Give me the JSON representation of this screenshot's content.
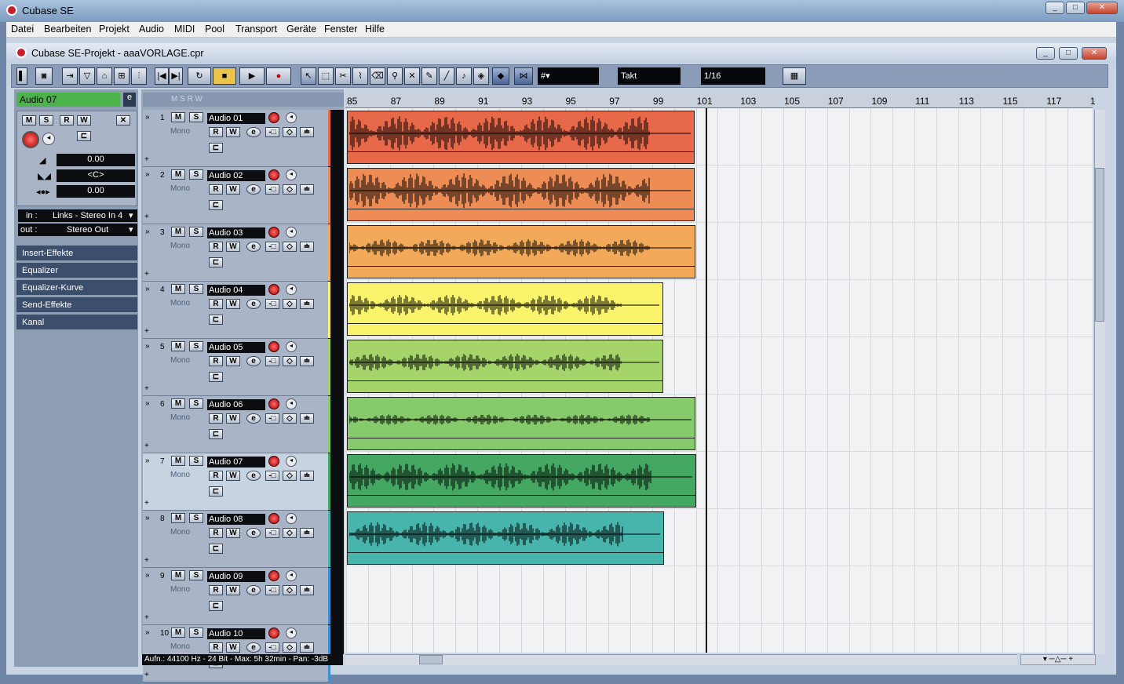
{
  "app": {
    "title": "Cubase SE"
  },
  "menu": [
    "Datei",
    "Bearbeiten",
    "Projekt",
    "Audio",
    "MIDI",
    "Pool",
    "Transport",
    "Geräte",
    "Fenster",
    "Hilfe"
  ],
  "project": {
    "title": "Cubase SE-Projekt - aaaVORLAGE.cpr"
  },
  "toolbar": {
    "grid_label": "Takt",
    "quantize": "1/16",
    "transport_icons": [
      "go-start-icon",
      "go-end-icon",
      "cycle-icon",
      "stop-icon",
      "play-icon",
      "record-icon"
    ]
  },
  "inspector": {
    "track_name": "Audio 07",
    "volume": "0.00",
    "pan": "<C>",
    "delay": "0.00",
    "in_label": "in :",
    "in_value": "Links - Stereo In 4",
    "out_label": "out :",
    "out_value": "Stereo Out",
    "sections": [
      "Insert-Effekte",
      "Equalizer",
      "Equalizer-Kurve",
      "Send-Effekte",
      "Kanal"
    ]
  },
  "tracks": [
    {
      "num": "1",
      "name": "Audio 01",
      "mode": "Mono",
      "color": "#e8694a"
    },
    {
      "num": "2",
      "name": "Audio 02",
      "mode": "Mono",
      "color": "#ee8c55"
    },
    {
      "num": "3",
      "name": "Audio 03",
      "mode": "Mono",
      "color": "#f2aa5a"
    },
    {
      "num": "4",
      "name": "Audio 04",
      "mode": "Mono",
      "color": "#faf46c"
    },
    {
      "num": "5",
      "name": "Audio 05",
      "mode": "Mono",
      "color": "#a4d46a"
    },
    {
      "num": "6",
      "name": "Audio 06",
      "mode": "Mono",
      "color": "#86ca6c"
    },
    {
      "num": "7",
      "name": "Audio 07",
      "mode": "Mono",
      "color": "#44a863"
    },
    {
      "num": "8",
      "name": "Audio 08",
      "mode": "Mono",
      "color": "#47b5ac"
    },
    {
      "num": "9",
      "name": "Audio 09",
      "mode": "Mono",
      "color": ""
    },
    {
      "num": "10",
      "name": "Audio 10",
      "mode": "Mono",
      "color": ""
    }
  ],
  "ruler": [
    "85",
    "87",
    "89",
    "91",
    "93",
    "95",
    "97",
    "99",
    "101",
    "103",
    "105",
    "107",
    "109",
    "111",
    "113",
    "115",
    "117",
    "1"
  ],
  "status": "Aufn.: 44100 Hz - 24 Bit - Max: 5h 32min - Pan: -3dB"
}
